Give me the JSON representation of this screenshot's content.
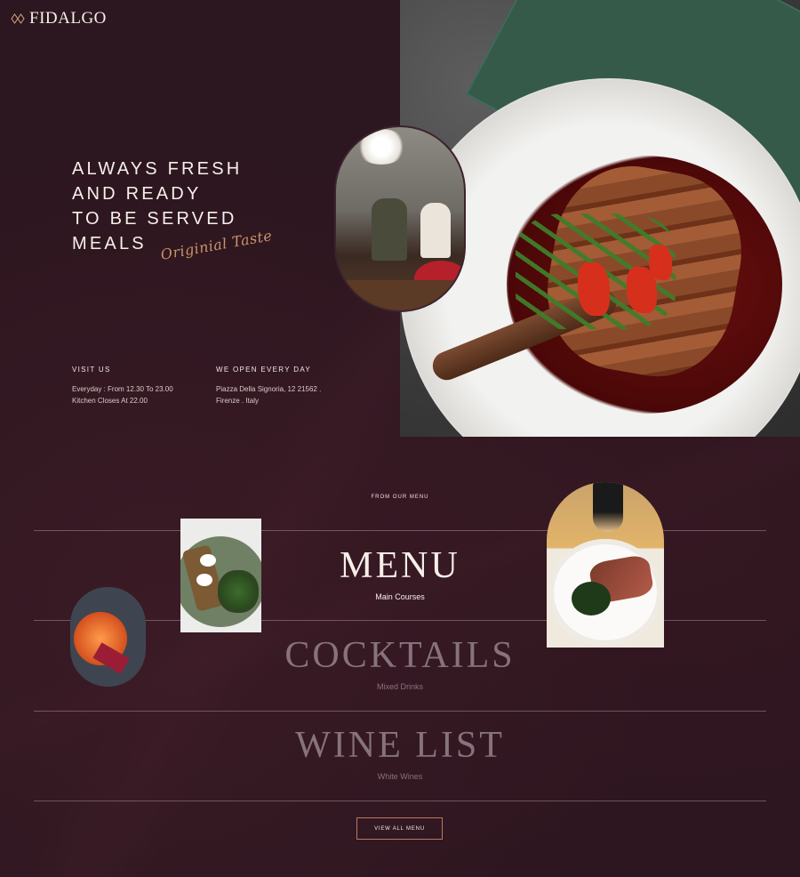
{
  "brand": {
    "name": "FIDALGO",
    "logo_icon": "diamond-logo-icon"
  },
  "nav": {
    "menu_icon": "hamburger-menu-icon"
  },
  "hero": {
    "tagline_lines": [
      "ALWAYS FRESH",
      "AND READY",
      "TO BE SERVED",
      "MEALS"
    ],
    "script_text": "Originial Taste"
  },
  "info": {
    "visit": {
      "heading": "VISIT US",
      "line1": "Everyday : From 12.30 To 23.00",
      "line2": "Kitchen Closes At 22.00"
    },
    "open": {
      "heading": "WE OPEN EVERY DAY",
      "line1": "Piazza Della Signoria, 12 21562 .",
      "line2": "Firenze . Italy"
    }
  },
  "menu_section": {
    "eyebrow": "FROM OUR MENU",
    "categories": [
      {
        "title": "MENU",
        "subtitle": "Main Courses",
        "active": true
      },
      {
        "title": "COCKTAILS",
        "subtitle": "Mixed Drinks",
        "active": false
      },
      {
        "title": "WINE LIST",
        "subtitle": "White Wines",
        "active": false
      }
    ],
    "button_label": "VIEW ALL MENU"
  },
  "colors": {
    "background": "#2c161f",
    "accent": "#c9946a",
    "dim_text": "#87737a"
  }
}
